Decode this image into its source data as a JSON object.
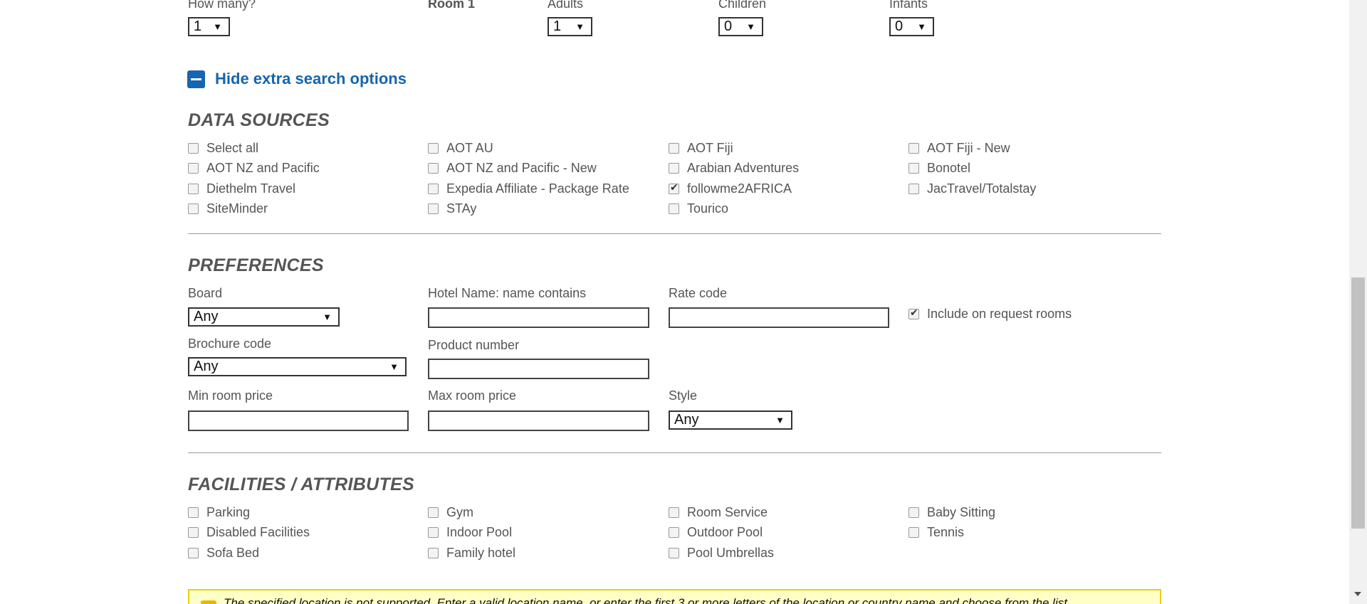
{
  "rooms": {
    "how_many_label": "How many?",
    "how_many_value": "1",
    "room_label": "Room 1",
    "adults_label": "Adults",
    "adults_value": "1",
    "children_label": "Children",
    "children_value": "0",
    "infants_label": "Infants",
    "infants_value": "0",
    "dropdown_arrow": "▼"
  },
  "toggle": {
    "label": "Hide extra search options",
    "icon": "minus-square-icon"
  },
  "data_sources": {
    "title": "DATA SOURCES",
    "items": [
      {
        "label": "Select all",
        "checked": false
      },
      {
        "label": "AOT AU",
        "checked": false
      },
      {
        "label": "AOT Fiji",
        "checked": false
      },
      {
        "label": "AOT Fiji - New",
        "checked": false
      },
      {
        "label": "AOT NZ and Pacific",
        "checked": false
      },
      {
        "label": "AOT NZ and Pacific - New",
        "checked": false
      },
      {
        "label": "Arabian Adventures",
        "checked": false
      },
      {
        "label": "Bonotel",
        "checked": false
      },
      {
        "label": "Diethelm Travel",
        "checked": false
      },
      {
        "label": "Expedia Affiliate - Package Rate",
        "checked": false
      },
      {
        "label": "followme2AFRICA",
        "checked": true
      },
      {
        "label": "JacTravel/Totalstay",
        "checked": false
      },
      {
        "label": "SiteMinder",
        "checked": false
      },
      {
        "label": "STAy",
        "checked": false
      },
      {
        "label": "Tourico",
        "checked": false
      }
    ]
  },
  "preferences": {
    "title": "PREFERENCES",
    "board_label": "Board",
    "board_value": "Any",
    "hotel_name_label": "Hotel Name: name contains",
    "hotel_name_value": "",
    "rate_code_label": "Rate code",
    "rate_code_value": "",
    "include_on_request_label": "Include on request rooms",
    "include_on_request_checked": true,
    "brochure_code_label": "Brochure code",
    "brochure_code_value": "Any",
    "product_number_label": "Product number",
    "product_number_value": "",
    "min_price_label": "Min room price",
    "min_price_value": "",
    "max_price_label": "Max room price",
    "max_price_value": "",
    "style_label": "Style",
    "style_value": "Any"
  },
  "facilities": {
    "title": "FACILITIES / ATTRIBUTES",
    "items": [
      {
        "label": "Parking",
        "checked": false
      },
      {
        "label": "Gym",
        "checked": false
      },
      {
        "label": "Room Service",
        "checked": false
      },
      {
        "label": "Baby Sitting",
        "checked": false
      },
      {
        "label": "Disabled Facilities",
        "checked": false
      },
      {
        "label": "Indoor Pool",
        "checked": false
      },
      {
        "label": "Outdoor Pool",
        "checked": false
      },
      {
        "label": "Tennis",
        "checked": false
      },
      {
        "label": "Sofa Bed",
        "checked": false
      },
      {
        "label": "Family hotel",
        "checked": false
      },
      {
        "label": "Pool Umbrellas",
        "checked": false
      }
    ]
  },
  "warning": {
    "text": "The specified location is not supported. Enter a valid location name, or enter the first 3 or more letters of the location or country name and choose from the list",
    "icon": "warning-icon"
  }
}
